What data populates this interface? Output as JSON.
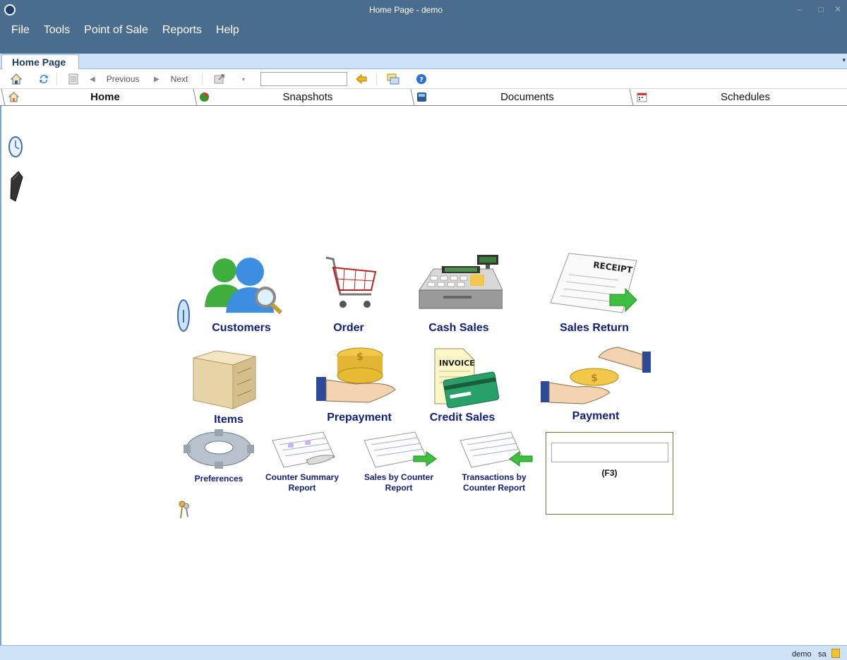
{
  "window": {
    "title": "Home Page - demo",
    "minimize": "–",
    "maximize": "□",
    "close": "✕"
  },
  "menu": [
    "File",
    "Tools",
    "Point of Sale",
    "Reports",
    "Help"
  ],
  "doc_tab": {
    "label": "Home Page"
  },
  "toolbar": {
    "previous_label": "Previous",
    "next_label": "Next",
    "search_value": ""
  },
  "content_tabs": [
    {
      "label": "Home",
      "icon": "home-icon",
      "active": true
    },
    {
      "label": "Snapshots",
      "icon": "pie-chart-icon",
      "active": false
    },
    {
      "label": "Documents",
      "icon": "documents-icon",
      "active": false
    },
    {
      "label": "Schedules",
      "icon": "calendar-icon",
      "active": false
    }
  ],
  "modules": {
    "customers": "Customers",
    "order": "Order",
    "cash_sales": "Cash Sales",
    "sales_return": "Sales Return",
    "items": "Items",
    "prepayment": "Prepayment",
    "credit_sales": "Credit Sales",
    "payment": "Payment",
    "preferences": "Preferences",
    "counter_summary": "Counter Summary Report",
    "sales_by_counter": "Sales by Counter Report",
    "transactions_by_counter": "Transactions by Counter Report"
  },
  "f3_panel": {
    "input_value": "",
    "label": "(F3)"
  },
  "status": {
    "database": "demo",
    "user": "sa"
  },
  "colors": {
    "titlebar": "#4a6d8d",
    "tabstrip": "#cce2f8",
    "module_label": "#10207a"
  }
}
